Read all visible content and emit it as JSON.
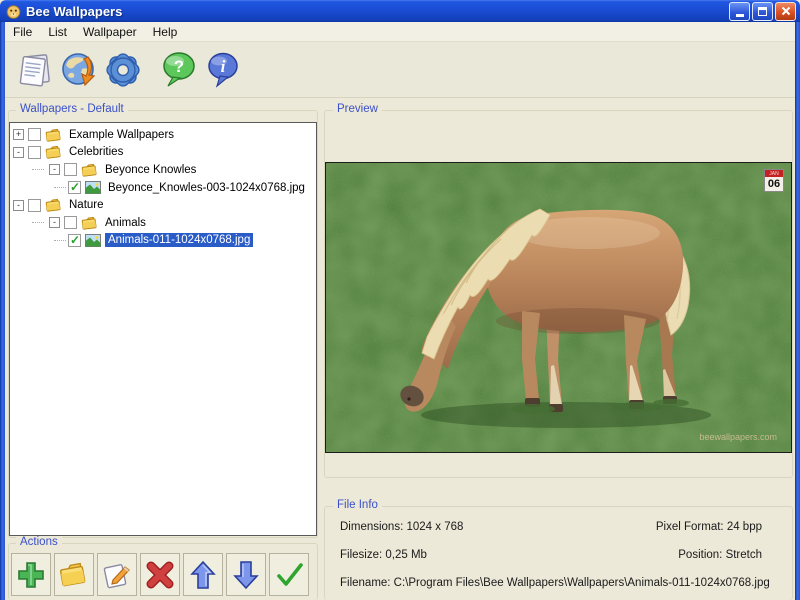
{
  "window": {
    "title": "Bee Wallpapers",
    "controls": [
      "minimize",
      "maximize",
      "close"
    ]
  },
  "menu": {
    "items": [
      "File",
      "List",
      "Wallpaper",
      "Help"
    ]
  },
  "toolbar": {
    "icons": [
      "documents",
      "web-download",
      "settings-gear",
      "help-balloon",
      "info-balloon"
    ]
  },
  "wallpapers_panel": {
    "label": "Wallpapers - Default",
    "tree": [
      {
        "label": "Example Wallpapers",
        "level": 0,
        "expander": "+",
        "checked": false,
        "type": "folder",
        "selected": false
      },
      {
        "label": "Celebrities",
        "level": 0,
        "expander": "-",
        "checked": false,
        "type": "folder",
        "selected": false
      },
      {
        "label": "Beyonce Knowles",
        "level": 1,
        "expander": "-",
        "checked": false,
        "type": "folder",
        "selected": false
      },
      {
        "label": "Beyonce_Knowles-003-1024x0768.jpg",
        "level": 2,
        "expander": "",
        "checked": true,
        "type": "image",
        "selected": false
      },
      {
        "label": "Nature",
        "level": 0,
        "expander": "-",
        "checked": false,
        "type": "folder",
        "selected": false
      },
      {
        "label": "Animals",
        "level": 1,
        "expander": "-",
        "checked": false,
        "type": "folder",
        "selected": false
      },
      {
        "label": "Animals-011-1024x0768.jpg",
        "level": 2,
        "expander": "",
        "checked": true,
        "type": "image",
        "selected": true
      }
    ]
  },
  "actions_panel": {
    "label": "Actions",
    "buttons": [
      "add",
      "new-folder",
      "edit",
      "delete",
      "move-up",
      "move-down",
      "apply"
    ]
  },
  "preview_panel": {
    "label": "Preview",
    "badge_day": "06",
    "watermark": "beewallpapers.com"
  },
  "file_info_panel": {
    "label": "File Info",
    "dimensions": "Dimensions: 1024 x 768",
    "pixel_format": "Pixel Format: 24 bpp",
    "filesize": "Filesize: 0,25 Mb",
    "position": "Position: Stretch",
    "filename": "Filename: C:\\Program Files\\Bee Wallpapers\\Wallpapers\\Animals-011-1024x0768.jpg"
  },
  "colors": {
    "titlebar_blue": "#1b4cd3",
    "selection_blue": "#2a5cc8",
    "groupbox_label_blue": "#3b50c8",
    "window_bg": "#ece9d8"
  }
}
